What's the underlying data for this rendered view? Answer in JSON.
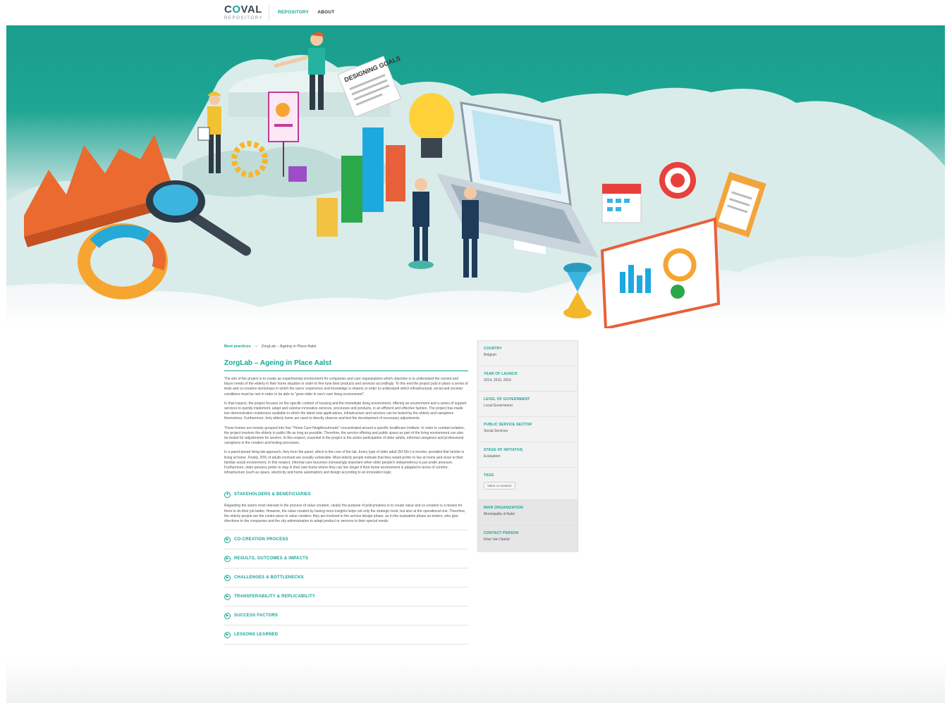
{
  "header": {
    "logo_main_a": "C",
    "logo_main_o": "O",
    "logo_main_b": "VAL",
    "logo_sub": "REPOSITORY",
    "nav": [
      {
        "label": "REPOSITORY",
        "active": true
      },
      {
        "label": "ABOUT",
        "active": false
      }
    ]
  },
  "hero": {
    "image_alt": "Isometric illustration of people, charts, laptop and icons on a world map",
    "sign_text": "DESIGNING GOALS"
  },
  "breadcrumb": {
    "root": "Best practices",
    "arrow": "→",
    "current": "ZorgLab – Ageing in Place Aalst"
  },
  "article": {
    "title": "ZorgLab – Ageing in Place Aalst",
    "paragraphs": [
      "The aim of the project is to create an experimental environment for companies and care organizations which objective is to understand the current and future needs of the elderly in their home situation in order to fine tune their products and services accordingly. To this end the project puts in place a series of tests and co-creation workshops in which the users' experience and knowledge is shared, in order to understand which infrastructural, social and societal conditions must be met in order to be able to \"grow older in one's own living environment\".",
      "In that respect, the project focuses on the specific context of housing and the immediate living environment, offering an environment and a series of support services to quickly implement, adapt and valorise innovative services, processes and products, in an efficient and effective fashion. The project has made two demonstration residences available in which the latest new applications, infrastructure and services can be tested by the elderly and caregivers themselves. Furthermore, forty elderly home are used to directly observe and test the development of necessary adjustments.",
      "These homes are loosely grouped into four \"Home Care Neighbourhoods\" concentrated around a specific healthcare institute. In order to combat isolation, the project involves the elderly in public life as long as possible. Therefore, the service offering and public space as part of the living environment can also be tested for adjustments for seniors. In this respect, essential in the project is the active participation of older adults, informal caregivers and professional caregivers in the creation and testing processes.",
      "In a panel-based living lab approach, they form the panel, which is the core of the lab. Every type of older adult (50-55+) is involve, provided that he/she is living at home. Finally, 20% of adults involved are socially vulnerable. Most elderly people indicate that they would prefer to live at home and close to their familiar social environment. In this respect, informal care becomes increasingly important when older people's independency is put under pressure. Furthermore, older persons prefer to stay in their own home where they can live longer if their home environment is adapted in terms of comfort, infrastructure (such as space, electricity and home automation) and design according to an innovation logic."
    ]
  },
  "accordions": [
    {
      "label": "STAKEHOLDERS & BENEFICIARIES",
      "expanded": true,
      "body": "Regarding the actors most relevant in the process of value creation, clearly the purpose of policymakers is to create value and co-creation is a means for them to do their job better. However, the value created by having more insights helps not only the strategic level, but also at the operational one. Therefore, the elderly people are the centre piece in value creation: they are involved in the service design phase, as in the evaluation phase as testers, who give directions to the companies and the city administration to adapt product or services to their special needs."
    },
    {
      "label": "CO-CREATION PROCESS",
      "expanded": false
    },
    {
      "label": "RESULTS, OUTCOMES & IMPACTS",
      "expanded": false
    },
    {
      "label": "CHALLENGES & BOTTLENECKS",
      "expanded": false
    },
    {
      "label": "TRANSFERABILITY & REPLICABILITY",
      "expanded": false
    },
    {
      "label": "SUCCESS FACTORS",
      "expanded": false
    },
    {
      "label": "LESSONS LEARNED",
      "expanded": false
    }
  ],
  "sidebar": {
    "items": [
      {
        "label": "COUNTRY",
        "value": "Belgium"
      },
      {
        "label": "YEAR OF LAUNCH",
        "value": "2014, 2015, 2016"
      },
      {
        "label": "LEVEL OF GOVERNMENT",
        "value": "Local Government"
      },
      {
        "label": "PUBLIC SERVICE SECTOR",
        "value": "Social Services"
      },
      {
        "label": "STAGE OF INITIATIVE",
        "value": "Evaluation"
      },
      {
        "label": "TAGS",
        "tag": "Value co-creation"
      },
      {
        "label": "MAIN ORGANIZATION",
        "value": "Municipality of Aalst"
      },
      {
        "label": "CONTACT PERSON",
        "value": "Elise Van Opstal"
      }
    ]
  },
  "colors": {
    "accent": "#17a598",
    "hero_top": "#1a9e8d",
    "text": "#555555"
  }
}
